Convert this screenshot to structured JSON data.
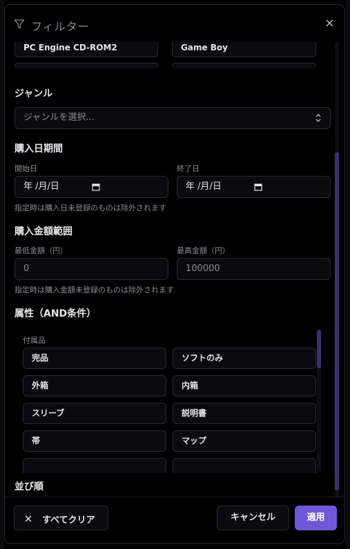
{
  "dialog": {
    "title": "フィルター",
    "close_icon": "close-icon",
    "filter_icon": "filter-icon"
  },
  "platforms": [
    "PC Engine CD-ROM2",
    "Game Boy"
  ],
  "genre": {
    "title": "ジャンル",
    "placeholder": "ジャンルを選択..."
  },
  "purchase_date": {
    "title": "購入日期間",
    "start_label": "開始日",
    "end_label": "終了日",
    "start_value": "年 /月/日",
    "end_value": "年 /月/日",
    "note": "指定時は購入日未登録のものは除外されます"
  },
  "price": {
    "title": "購入金額範囲",
    "min_label": "最低金額（円）",
    "max_label": "最高金額（円）",
    "min_placeholder": "0",
    "max_placeholder": "100000",
    "note": "指定時は購入金額未登録のものは除外されます"
  },
  "attributes": {
    "title": "属性（AND条件）",
    "group_label": "付属品",
    "items": [
      "完品",
      "ソフトのみ",
      "外箱",
      "内箱",
      "スリーブ",
      "説明書",
      "帯",
      "マップ"
    ]
  },
  "sort": {
    "title": "並び順"
  },
  "footer": {
    "clear_label": "すべてクリア",
    "cancel_label": "キャンセル",
    "apply_label": "適用"
  },
  "colors": {
    "accent": "#6f58d8",
    "scrollbar": "#3b3170"
  }
}
